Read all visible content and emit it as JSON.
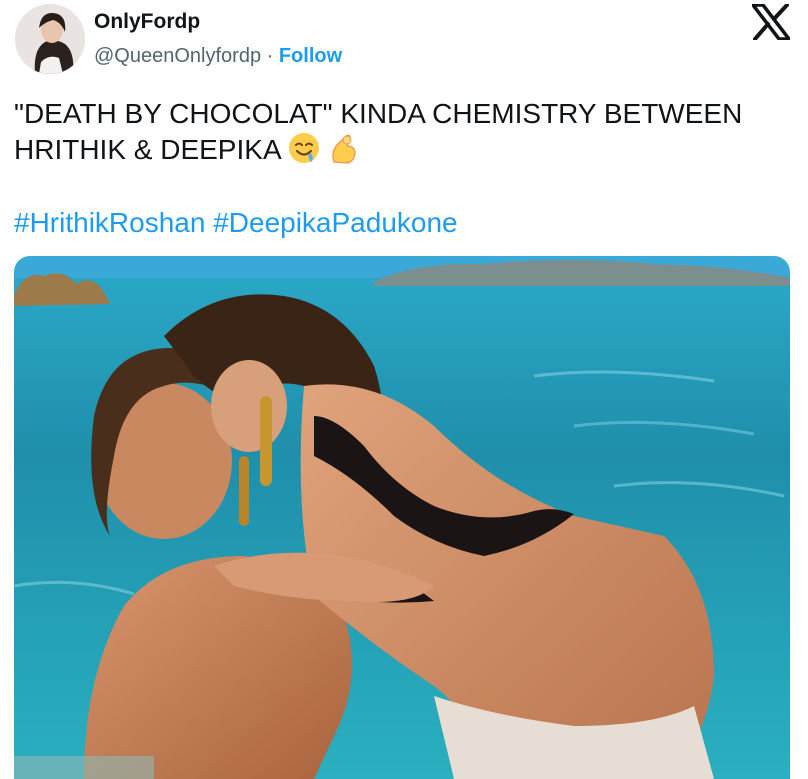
{
  "tweet": {
    "display_name": "OnlyFordp",
    "handle": "@QueenOnlyfordp",
    "separator": " · ",
    "follow_label": "Follow",
    "text_line1": "\"DEATH BY CHOCOLAT\" KINDA CHEMISTRY BETWEEN",
    "text_line2": "HRITHIK & DEEPIKA",
    "emojis": [
      "drooling-face-emoji",
      "pinched-fingers-emoji"
    ],
    "hashtags": [
      "#HrithikRoshan",
      "#DeepikaPadukone"
    ]
  },
  "icons": {
    "brand": "x-logo-icon"
  },
  "media": {
    "type": "photo",
    "description_icon": "beach-photo"
  },
  "colors": {
    "link": "#1d9bf0",
    "text": "#0f1419",
    "secondary": "#536471",
    "sea": "#1f93ad"
  }
}
